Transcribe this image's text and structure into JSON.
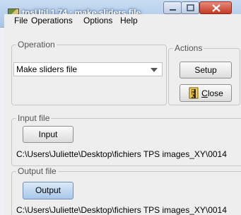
{
  "window": {
    "title": "tpsUtil 1.74 : make sliders file"
  },
  "menu": {
    "items": [
      "File",
      "Operations",
      "Options",
      "Help"
    ]
  },
  "operation": {
    "legend": "Operation",
    "selected": "Make sliders file"
  },
  "actions": {
    "legend": "Actions",
    "setup_label": "Setup",
    "close_mnemonic": "C",
    "close_rest": "lose"
  },
  "input_file": {
    "legend": "Input file",
    "button_label": "Input",
    "path": "C:\\Users\\Juliette\\Desktop\\fichiers TPS images_XY\\0014"
  },
  "output_file": {
    "legend": "Output file",
    "button_label": "Output",
    "path": "C:\\Users\\Juliette\\Desktop\\fichiers TPS images_XY\\0014"
  },
  "colors": {
    "titlebar": "#b7cfee",
    "client": "#eeeeee",
    "close_button": "#c43a23",
    "output_button": "#a9c7e9"
  }
}
